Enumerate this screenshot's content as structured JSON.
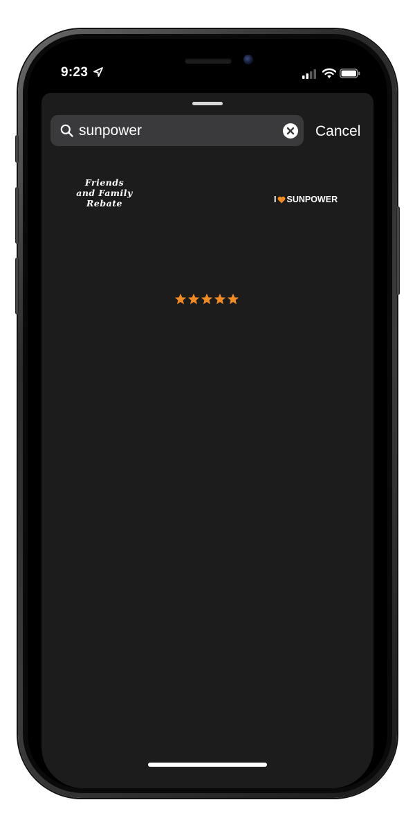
{
  "status_bar": {
    "time": "9:23"
  },
  "search": {
    "query": "sunpower",
    "cancel_label": "Cancel"
  },
  "results": {
    "friends_sticker": {
      "line1": "Friends",
      "line2": "and Family",
      "line3": "Rebate"
    },
    "sunpower_sticker": {
      "prefix": "I",
      "brand": "SUNPOWER"
    },
    "stars_sticker": {
      "rating": 5,
      "max": 5
    }
  },
  "colors": {
    "sheet_background": "#1c1c1c",
    "search_field": "#3a3a3c",
    "accent_orange": "#f08a24",
    "text": "#ffffff"
  },
  "icons": [
    "location-arrow-icon",
    "cellular-signal-icon",
    "wifi-icon",
    "battery-icon",
    "search-icon",
    "clear-icon",
    "heart-icon",
    "star-icon"
  ]
}
